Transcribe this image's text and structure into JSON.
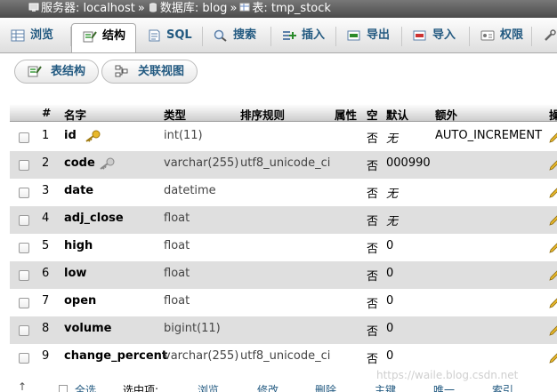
{
  "breadcrumb": {
    "server_label": "服务器: localhost",
    "sep1": "»",
    "db_label": "数据库: blog",
    "sep2": "»",
    "table_label": "表: tmp_stock"
  },
  "tabs": [
    {
      "label": "浏览",
      "icon": "browse-icon"
    },
    {
      "label": "结构",
      "icon": "structure-icon",
      "active": true
    },
    {
      "label": "SQL",
      "icon": "sql-icon"
    },
    {
      "label": "搜索",
      "icon": "search-icon"
    },
    {
      "label": "插入",
      "icon": "insert-icon"
    },
    {
      "label": "导出",
      "icon": "export-icon"
    },
    {
      "label": "导入",
      "icon": "import-icon"
    },
    {
      "label": "权限",
      "icon": "privileges-icon"
    }
  ],
  "subtabs": {
    "structure_label": "表结构",
    "relation_label": "关联视图"
  },
  "table": {
    "headers": [
      "#",
      "名字",
      "类型",
      "排序规则",
      "属性",
      "空",
      "默认",
      "额外",
      "操"
    ],
    "rows": [
      {
        "num": "1",
        "name": "id",
        "type": "int(11)",
        "collation": "",
        "attributes": "",
        "null": "否",
        "default": "无",
        "default_italic": true,
        "extra": "AUTO_INCREMENT",
        "key": "primary"
      },
      {
        "num": "2",
        "name": "code",
        "type": "varchar(255)",
        "collation": "utf8_unicode_ci",
        "attributes": "",
        "null": "否",
        "default": "000990",
        "default_italic": false,
        "extra": "",
        "key": "index"
      },
      {
        "num": "3",
        "name": "date",
        "type": "datetime",
        "collation": "",
        "attributes": "",
        "null": "否",
        "default": "无",
        "default_italic": true,
        "extra": ""
      },
      {
        "num": "4",
        "name": "adj_close",
        "type": "float",
        "collation": "",
        "attributes": "",
        "null": "否",
        "default": "无",
        "default_italic": true,
        "extra": ""
      },
      {
        "num": "5",
        "name": "high",
        "type": "float",
        "collation": "",
        "attributes": "",
        "null": "否",
        "default": "0",
        "default_italic": false,
        "extra": ""
      },
      {
        "num": "6",
        "name": "low",
        "type": "float",
        "collation": "",
        "attributes": "",
        "null": "否",
        "default": "0",
        "default_italic": false,
        "extra": ""
      },
      {
        "num": "7",
        "name": "open",
        "type": "float",
        "collation": "",
        "attributes": "",
        "null": "否",
        "default": "0",
        "default_italic": false,
        "extra": ""
      },
      {
        "num": "8",
        "name": "volume",
        "type": "bigint(11)",
        "collation": "",
        "attributes": "",
        "null": "否",
        "default": "0",
        "default_italic": false,
        "extra": ""
      },
      {
        "num": "9",
        "name": "change_percent",
        "type": "varchar(255)",
        "collation": "utf8_unicode_ci",
        "attributes": "",
        "null": "否",
        "default": "0",
        "default_italic": false,
        "extra": ""
      }
    ]
  },
  "bottom": {
    "check_all": "全选",
    "with_selected": "选中项:",
    "browse": "浏览",
    "change": "修改",
    "drop": "删除",
    "primary": "主键",
    "unique": "唯一",
    "index": "索引"
  },
  "watermark": "https://waile.blog.csdn.net",
  "colors": {
    "link": "#235a81",
    "row_alt": "#dfdfdf",
    "breadcrumb_bg": "#5a5a5a"
  }
}
